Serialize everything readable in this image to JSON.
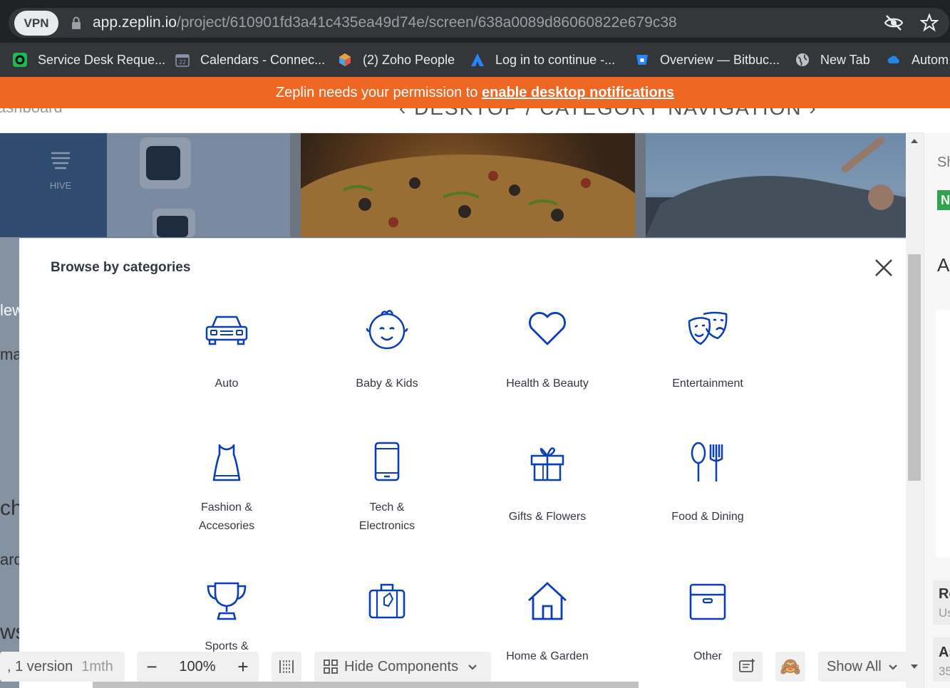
{
  "browser": {
    "vpn_label": "VPN",
    "url_host": "app.zeplin.io",
    "url_path": "/project/610901fd3a41c435ea49d74e/screen/638a0089d86060822e679c38"
  },
  "bookmarks": [
    {
      "label": "Service Desk Reque...",
      "icon": "service-desk-icon",
      "color": "#1db954"
    },
    {
      "label": "Calendars - Connec...",
      "icon": "calendar-icon",
      "color": "#5f6b8a"
    },
    {
      "label": "(2) Zoho People",
      "icon": "zoho-icon",
      "color": "#e9a23b"
    },
    {
      "label": "Log in to continue -...",
      "icon": "atlassian-icon",
      "color": "#2684ff"
    },
    {
      "label": "Overview — Bitbuc...",
      "icon": "bitbucket-icon",
      "color": "#2684ff"
    },
    {
      "label": "New Tab",
      "icon": "globe-icon",
      "color": "#bdc1c6"
    },
    {
      "label": "Autom",
      "icon": "cloud-icon",
      "color": "#1e88e5"
    }
  ],
  "notice": {
    "text": "Zeplin needs your permission to ",
    "link": "enable desktop notifications"
  },
  "app": {
    "breadcrumb": "ashboard",
    "screen_title": "DESKTOP / CATEGORY NAVIGATION",
    "left_fragments": [
      "lew",
      "mar",
      "ch",
      "ard",
      "wse"
    ]
  },
  "modal": {
    "title": "Browse by categories",
    "categories": [
      {
        "label": "Auto",
        "icon": "car-icon"
      },
      {
        "label": "Baby & Kids",
        "icon": "baby-face-icon"
      },
      {
        "label": "Health & Beauty",
        "icon": "heart-icon"
      },
      {
        "label": "Entertainment",
        "icon": "theatre-masks-icon"
      },
      {
        "label": "Fashion &\nAccesories",
        "icon": "dress-icon"
      },
      {
        "label": "Tech &\nElectronics",
        "icon": "smartphone-icon"
      },
      {
        "label": "Gifts & Flowers",
        "icon": "gift-icon"
      },
      {
        "label": "Food & Dining",
        "icon": "cutlery-icon"
      },
      {
        "label": "Sports &",
        "icon": "trophy-icon"
      },
      {
        "label": "",
        "icon": "luggage-icon"
      },
      {
        "label": "Home & Garden",
        "icon": "house-icon"
      },
      {
        "label": "Other",
        "icon": "box-icon"
      }
    ]
  },
  "right_panel": {
    "fragments": [
      "Sh",
      "N",
      "A",
      "Re",
      "Us",
      "As",
      "35"
    ]
  },
  "toolbar": {
    "version": ", 1 version",
    "version_age": "1mth",
    "zoom": "100%",
    "hide_components": "Hide Components",
    "show_all": "Show All"
  },
  "colors": {
    "brand_orange": "#ee6723",
    "icon_blue": "#0a3db8"
  }
}
